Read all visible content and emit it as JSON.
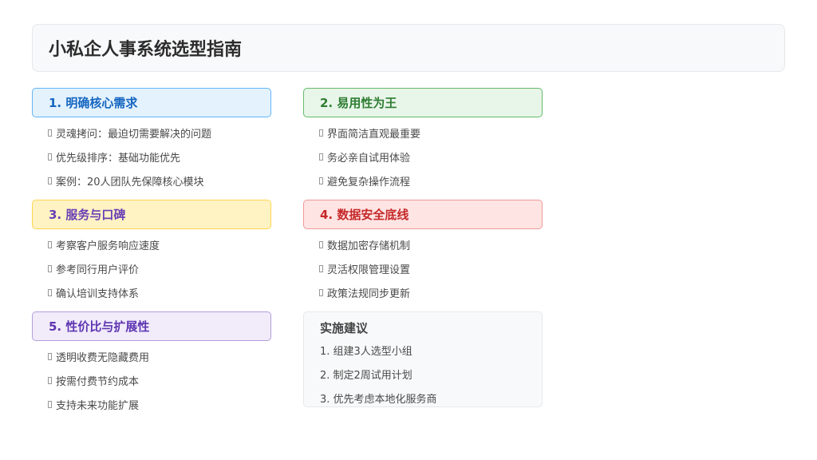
{
  "page": {
    "title": "小私企人事系统选型指南"
  },
  "sections": [
    {
      "title": "1. 明确核心需求",
      "colors": {
        "bg": "#e3f2fd",
        "border": "#64b5f6",
        "text": "#1565c0"
      },
      "items": [
        "灵魂拷问：最迫切需要解决的问题",
        "优先级排序：基础功能优先",
        "案例：20人团队先保障核心模块"
      ]
    },
    {
      "title": "2. 易用性为王",
      "colors": {
        "bg": "#e8f5e9",
        "border": "#66bb6a",
        "text": "#2e7d32"
      },
      "items": [
        "界面简洁直观最重要",
        "务必亲自试用体验",
        "避免复杂操作流程"
      ]
    },
    {
      "title": "3. 服务与口碑",
      "colors": {
        "bg": "#fff3c4",
        "border": "#ffd54f",
        "text": "#6a3fb5"
      },
      "items": [
        "考察客户服务响应速度",
        "参考同行用户评价",
        "确认培训支持体系"
      ]
    },
    {
      "title": "4. 数据安全底线",
      "colors": {
        "bg": "#ffe4e4",
        "border": "#ef9a9a",
        "text": "#c62828"
      },
      "items": [
        "数据加密存储机制",
        "灵活权限管理设置",
        "政策法规同步更新"
      ]
    },
    {
      "title": "5. 性价比与扩展性",
      "colors": {
        "bg": "#f1ebfa",
        "border": "#b39ddb",
        "text": "#5e35b1"
      },
      "items": [
        "透明收费无隐藏费用",
        "按需付费节约成本",
        "支持未来功能扩展"
      ]
    }
  ],
  "tips": {
    "title": "实施建议",
    "items": [
      "1. 组建3人选型小组",
      "2. 制定2周试用计划",
      "3. 优先考虑本地化服务商"
    ]
  }
}
